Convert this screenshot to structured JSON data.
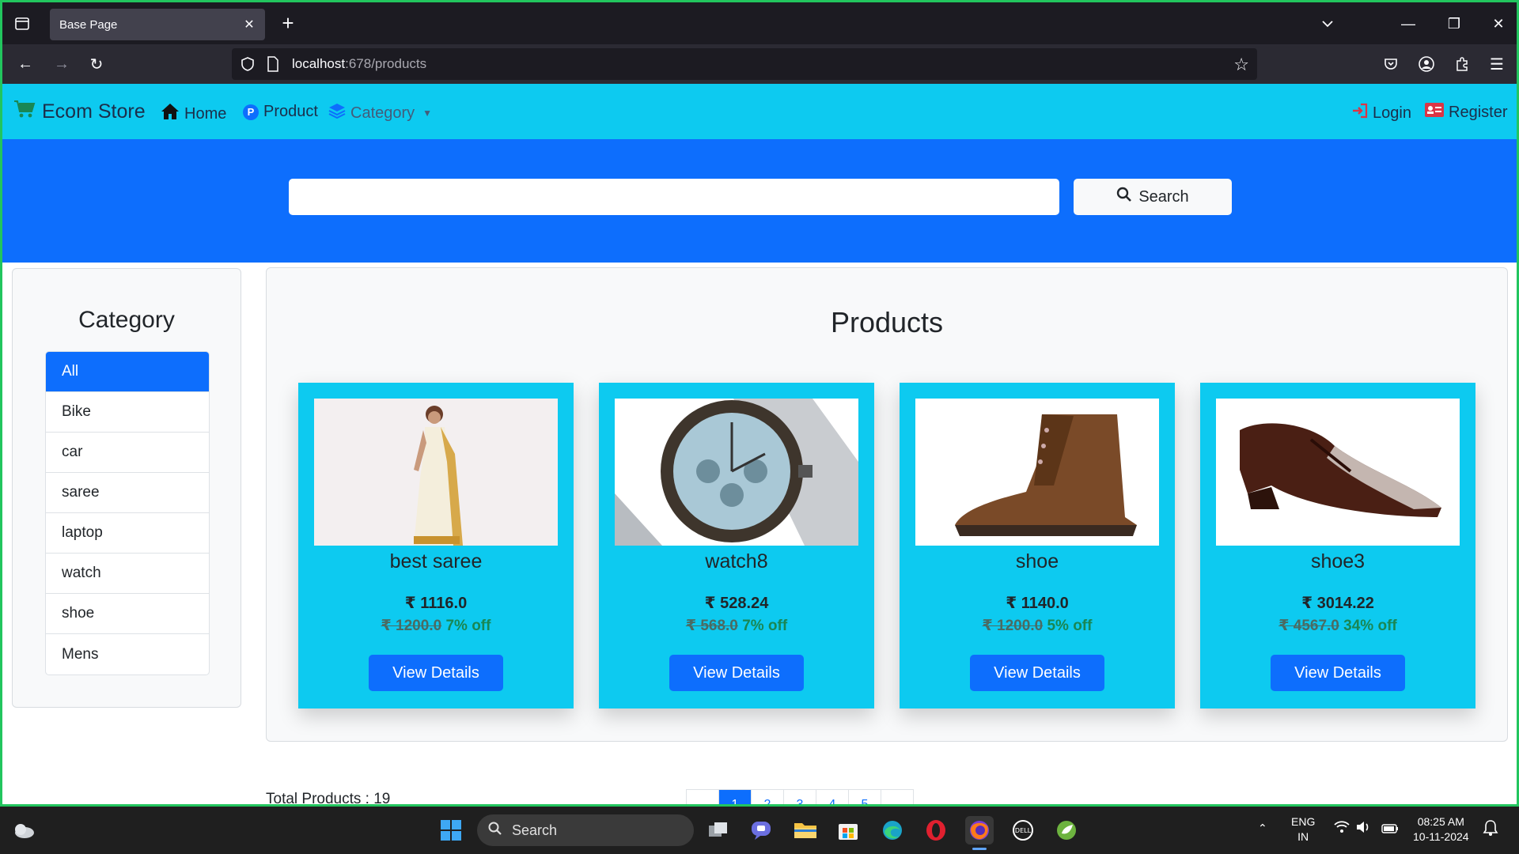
{
  "browser": {
    "tab_title": "Base Page",
    "url_host": "localhost",
    "url_path": ":678/products"
  },
  "nav": {
    "brand": "Ecom Store",
    "home": "Home",
    "product": "Product",
    "category": "Category",
    "login": "Login",
    "register": "Register"
  },
  "search": {
    "placeholder": "",
    "button": "Search"
  },
  "sidebar": {
    "title": "Category",
    "items": [
      "All",
      "Bike",
      "car",
      "saree",
      "laptop",
      "watch",
      "shoe",
      "Mens"
    ],
    "active_index": 0
  },
  "products": {
    "title": "Products",
    "items": [
      {
        "name": "best saree",
        "price": "₹ 1116.0",
        "original": "₹ 1200.0",
        "discount": "7% off",
        "button": "View Details"
      },
      {
        "name": "watch8",
        "price": "₹ 528.24",
        "original": "₹ 568.0",
        "discount": "7% off",
        "button": "View Details"
      },
      {
        "name": "shoe",
        "price": "₹ 1140.0",
        "original": "₹ 1200.0",
        "discount": "5% off",
        "button": "View Details"
      },
      {
        "name": "shoe3",
        "price": "₹ 3014.22",
        "original": "₹ 4567.0",
        "discount": "34% off",
        "button": "View Details"
      }
    ]
  },
  "footer": {
    "total": "Total Products : 19",
    "pages": [
      "",
      "1",
      "2",
      "3",
      "4",
      "5",
      ""
    ]
  },
  "taskbar": {
    "search": "Search",
    "lang_top": "ENG",
    "lang_bottom": "IN",
    "time": "08:25 AM",
    "date": "10-11-2024"
  },
  "colors": {
    "accent": "#0d6efd",
    "navbar": "#0dcaf0",
    "success": "#198754"
  }
}
